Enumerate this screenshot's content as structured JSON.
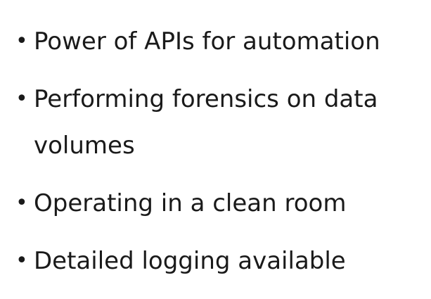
{
  "bullets": [
    {
      "text": "Power of APIs for automation"
    },
    {
      "text": "Performing forensics on data volumes"
    },
    {
      "text": "Operating in a clean room"
    },
    {
      "text": "Detailed logging available"
    }
  ],
  "bullet_glyph": "•"
}
